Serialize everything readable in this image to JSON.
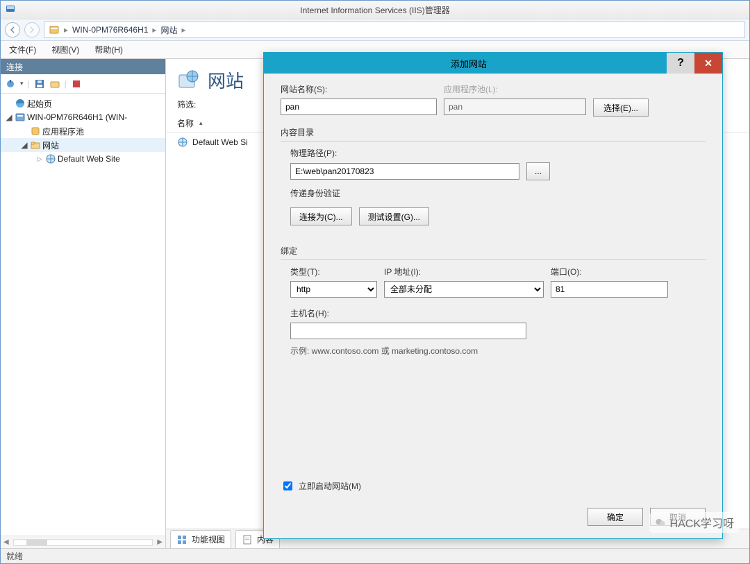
{
  "titlebar": {
    "title": "Internet Information Services (IIS)管理器"
  },
  "addr": {
    "segment1": "WIN-0PM76R646H1",
    "segment2": "网站"
  },
  "menu": {
    "file": "文件(F)",
    "view": "视图(V)",
    "help": "帮助(H)"
  },
  "connections": {
    "header": "连接",
    "items": {
      "start": "起始页",
      "server": "WIN-0PM76R646H1 (WIN-",
      "apppools": "应用程序池",
      "sites": "网站",
      "default": "Default Web Site"
    }
  },
  "main": {
    "heading": "网站",
    "filter_label": "筛选:",
    "columns": {
      "name": "名称"
    },
    "rows": {
      "default": "Default Web Si"
    },
    "tabs": {
      "features": "功能视图",
      "content": "内容"
    }
  },
  "status": {
    "ready": "就绪"
  },
  "dialog": {
    "title": "添加网站",
    "site_name_label": "网站名称(S):",
    "site_name_value": "pan",
    "app_pool_label": "应用程序池(L):",
    "app_pool_value": "pan",
    "select_btn": "选择(E)...",
    "content_header": "内容目录",
    "phys_path_label": "物理路径(P):",
    "phys_path_value": "E:\\web\\pan20170823",
    "browse_btn": "...",
    "passthrough": "传递身份验证",
    "connect_as": "连接为(C)...",
    "test_settings": "测试设置(G)...",
    "binding_header": "绑定",
    "type_label": "类型(T):",
    "type_value": "http",
    "ip_label": "IP 地址(I):",
    "ip_value": "全部未分配",
    "port_label": "端口(O):",
    "port_value": "81",
    "host_label": "主机名(H):",
    "host_value": "",
    "host_hint": "示例: www.contoso.com 或 marketing.contoso.com",
    "start_now_label": "立即启动网站(M)",
    "ok": "确定",
    "cancel": "取消"
  },
  "watermark": {
    "text": "HACK学习呀"
  }
}
